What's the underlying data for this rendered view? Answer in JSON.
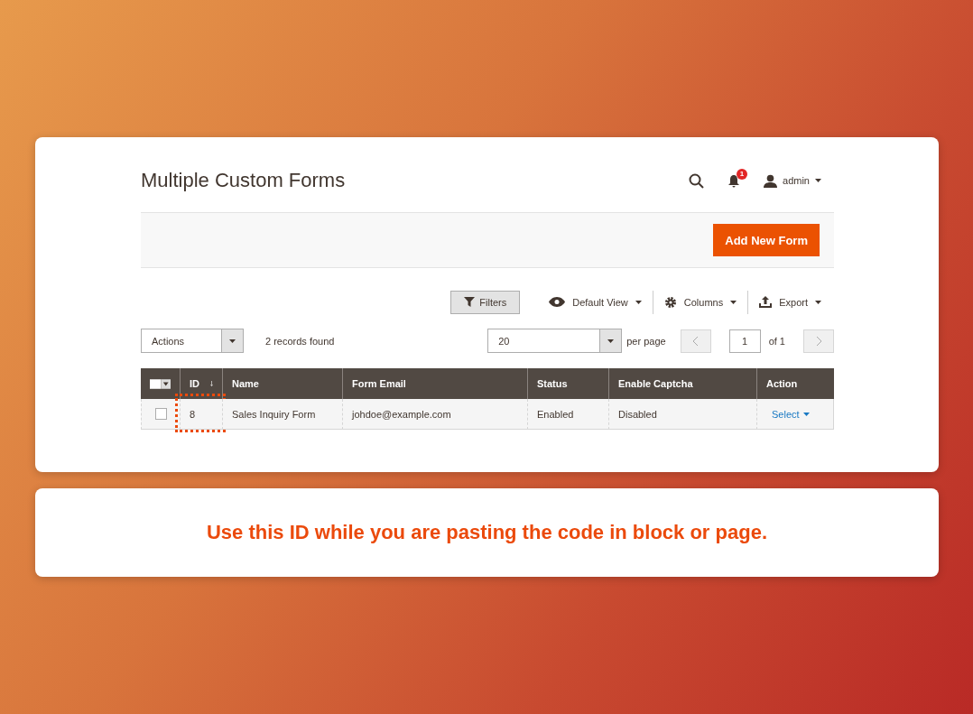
{
  "header": {
    "title": "Multiple Custom Forms",
    "notification_count": "1",
    "user": "admin"
  },
  "add_button": "Add New Form",
  "toolbar": {
    "filters": "Filters",
    "view": "Default View",
    "columns": "Columns",
    "export": "Export"
  },
  "controls": {
    "actions": "Actions",
    "records": "2 records found",
    "per_page_value": "20",
    "per_page_label": "per page",
    "page_number": "1",
    "page_total": "of 1"
  },
  "table": {
    "columns": [
      {
        "label": "ID",
        "sorted": true,
        "highlighted": true
      },
      {
        "label": "Name",
        "sorted": false,
        "highlighted": false
      },
      {
        "label": "Form Email",
        "sorted": false,
        "highlighted": false
      },
      {
        "label": "Status",
        "sorted": false,
        "highlighted": false
      },
      {
        "label": "Enable Captcha",
        "sorted": false,
        "highlighted": false
      },
      {
        "label": "Action",
        "sorted": false,
        "highlighted": false
      }
    ],
    "rows": [
      {
        "checked": false,
        "cells": [
          "8",
          "Sales Inquiry Form",
          "johdoe@example.com",
          "Enabled",
          "Disabled"
        ],
        "action": "Select"
      }
    ]
  },
  "callout": "Use this ID while you are pasting the code in block or page."
}
